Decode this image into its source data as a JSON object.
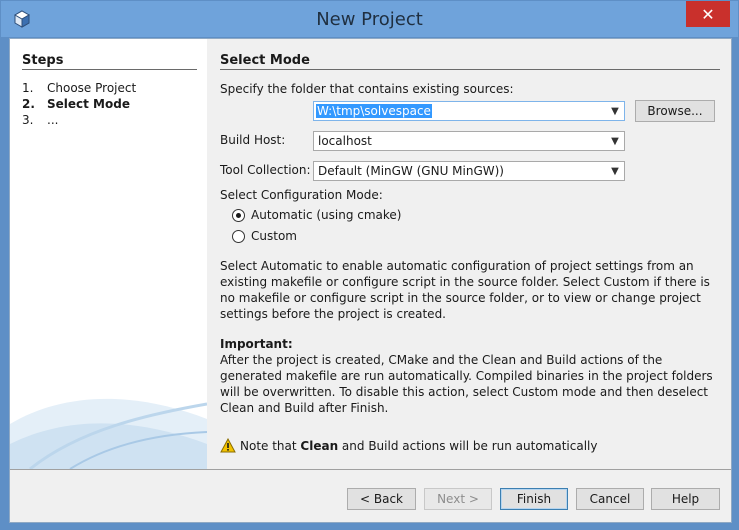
{
  "window": {
    "title": "New Project",
    "close_label": "✕"
  },
  "steps": {
    "title": "Steps",
    "items": [
      {
        "num": "1.",
        "label": "Choose Project"
      },
      {
        "num": "2.",
        "label": "Select Mode"
      },
      {
        "num": "3.",
        "label": "..."
      }
    ]
  },
  "main": {
    "title": "Select Mode",
    "folder_label": "Specify the folder that contains existing sources:",
    "folder_value": "W:\\tmp\\solvespace",
    "browse_label": "Browse...",
    "build_host_label": "Build Host:",
    "build_host_value": "localhost",
    "tool_collection_label": "Tool Collection:",
    "tool_collection_value": "Default (MinGW (GNU MinGW))",
    "config_mode_label": "Select Configuration Mode:",
    "radio_automatic": "Automatic (using cmake)",
    "radio_custom": "Custom",
    "description": "Select Automatic to enable automatic configuration of project settings from an existing makefile or configure script in the source folder. Select Custom if there is no makefile or configure script in the source folder, or to view or change project settings before the project is created.",
    "important_title": "Important:",
    "important_text": "After the project is created, CMake and the Clean and Build actions of the generated makefile are run automatically. Compiled binaries in the project folders will be overwritten. To disable this action, select Custom mode and then deselect Clean and Build after Finish.",
    "note_prefix": "Note that ",
    "note_bold": "Clean",
    "note_suffix": " and Build actions will be run automatically"
  },
  "footer": {
    "back_label": "< Back",
    "next_label": "Next >",
    "finish_label": "Finish",
    "cancel_label": "Cancel",
    "help_label": "Help"
  },
  "colors": {
    "title_bar": "#6fa3db",
    "close_button": "#c9302c",
    "selection": "#3399ff",
    "warning": "#f2c200"
  }
}
